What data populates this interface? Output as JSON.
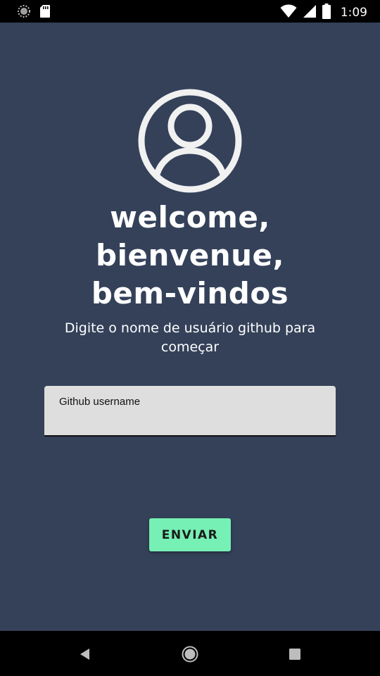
{
  "status_bar": {
    "time": "1:09",
    "icons": [
      "loading-spinner-icon",
      "sd-card-icon",
      "wifi-icon",
      "cell-signal-icon",
      "battery-icon"
    ]
  },
  "main": {
    "avatar_icon": "account-circle-icon",
    "welcome_lines": [
      "welcome,",
      "bienvenue,",
      "bem-vindos"
    ],
    "subtitle": "Digite o nome de usuário github para começar",
    "input": {
      "label": "Github username",
      "value": "",
      "placeholder": ""
    },
    "send_button_label": "ENVIAR"
  },
  "nav_bar": {
    "icons": [
      "back-icon",
      "home-icon",
      "recents-icon"
    ]
  },
  "colors": {
    "background": "#344159",
    "button": "#76f0b5",
    "input_background": "#dedede",
    "text": "#ffffff"
  }
}
